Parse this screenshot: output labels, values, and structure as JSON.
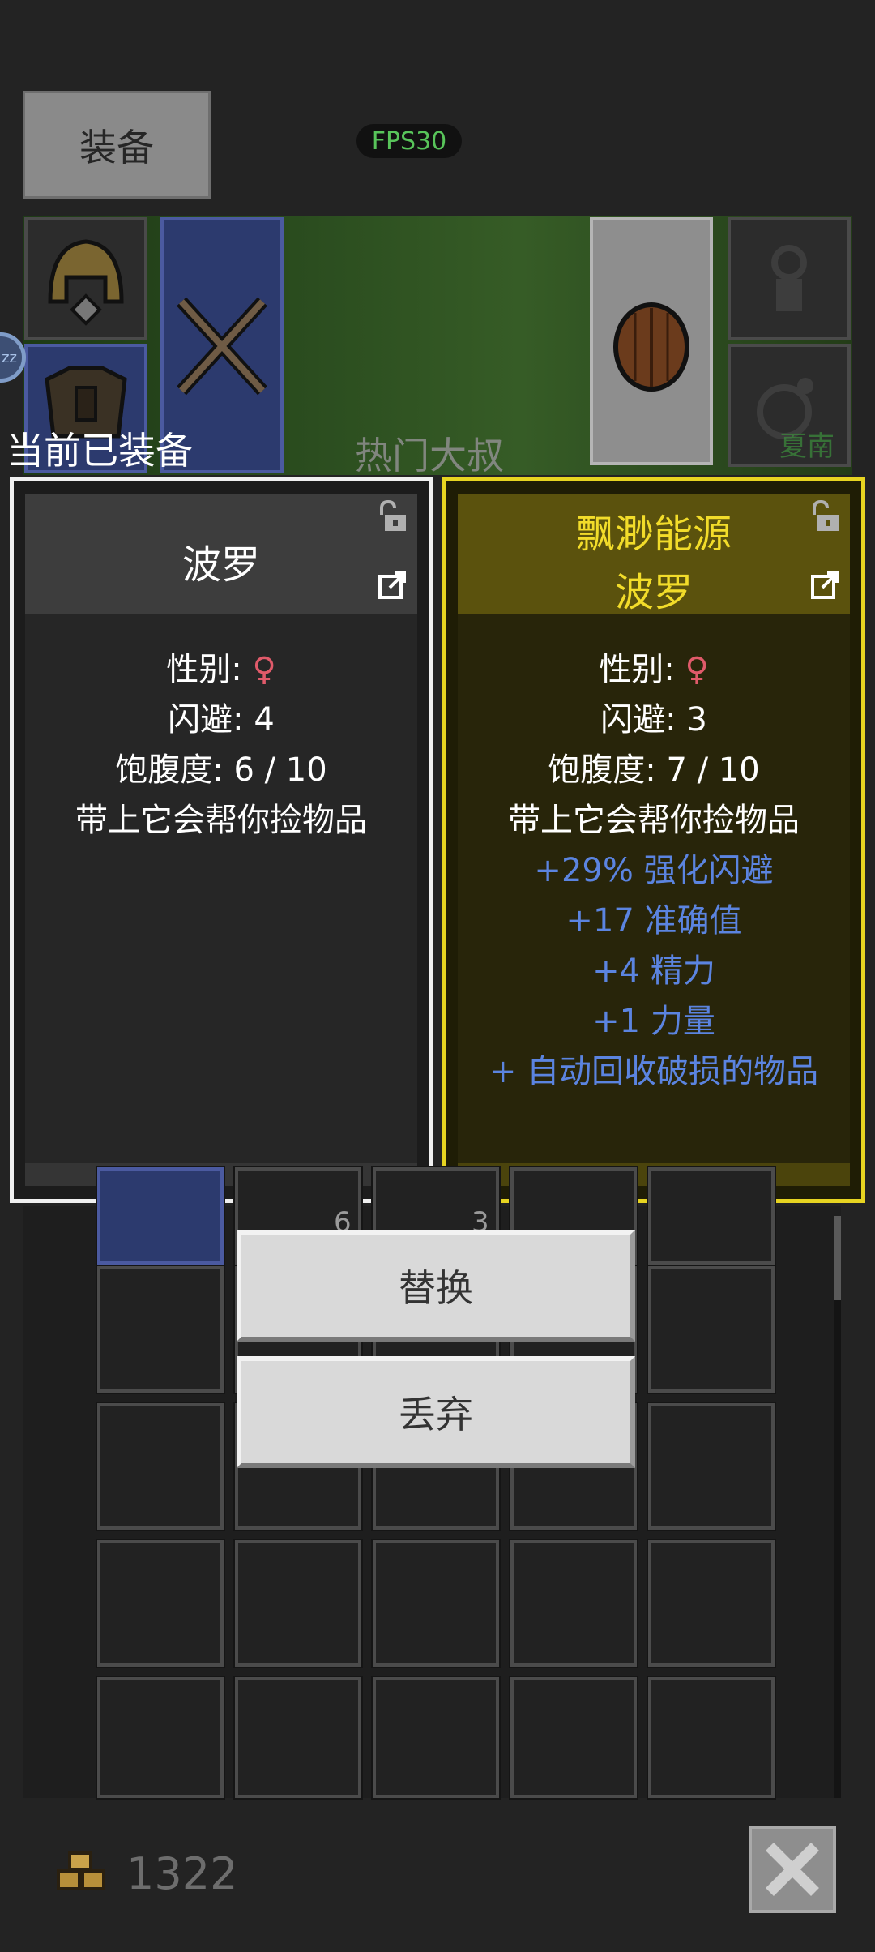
{
  "header": {
    "tab_label": "装备",
    "fps": "FPS30"
  },
  "scene": {
    "avatar_badge": "zz",
    "faded_text": "热门大叔",
    "faded_green_text": "夏南"
  },
  "current_equipped_label": "当前已装备",
  "panels": {
    "left": {
      "name": "波罗",
      "stats": [
        {
          "label": "性别: ",
          "value": "♀"
        },
        {
          "text": "闪避: 4"
        },
        {
          "text": "饱腹度: 6 / 10"
        },
        {
          "text": "带上它会帮你捡物品"
        }
      ]
    },
    "right": {
      "prefix": "飘渺能源",
      "name": "波罗",
      "stats": [
        {
          "label": "性别: ",
          "value": "♀"
        },
        {
          "text": "闪避: 3"
        },
        {
          "text": "饱腹度: 7 / 10"
        },
        {
          "text": "带上它会帮你捡物品"
        }
      ],
      "bonuses": [
        "+29% 强化闪避",
        "+17 准确值",
        "+4 精力",
        "+1 力量",
        "+ 自动回收破损的物品"
      ]
    }
  },
  "inventory": {
    "partial_counts": [
      "6",
      "3"
    ]
  },
  "actions": {
    "replace_label": "替换",
    "discard_label": "丢弃"
  },
  "footer": {
    "gold": "1322"
  },
  "colors": {
    "accent_yellow": "#e7d421",
    "bonus_blue": "#5b84e0",
    "female_pink": "#e05a6a",
    "fps_green": "#58c45a"
  }
}
